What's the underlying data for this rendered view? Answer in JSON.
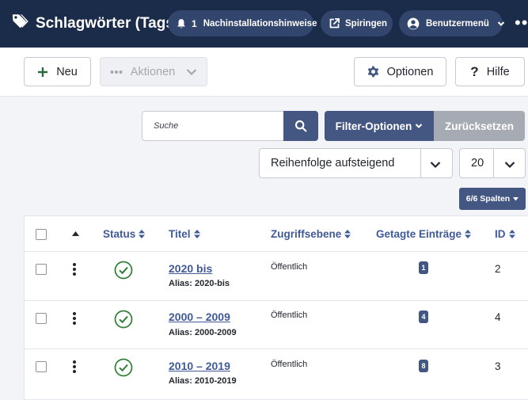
{
  "header": {
    "title": "Schlagwörter (Tags)",
    "notifications_count": "1",
    "notifications_label": "Nachinstallationshinweise",
    "site_label": "Spiringen",
    "user_menu_label": "Benutzermenü",
    "more_label": "••"
  },
  "toolbar": {
    "new_label": "Neu",
    "actions_label": "Aktionen",
    "options_label": "Optionen",
    "help_label": "Hilfe"
  },
  "filters": {
    "search_placeholder": "Suche",
    "filter_options_label": "Filter-Optionen",
    "reset_label": "Zurücksetzen",
    "ordering_value": "Reihenfolge aufsteigend",
    "limit_value": "20",
    "columns_label": "6/6 Spalten"
  },
  "table": {
    "columns": {
      "status": "Status",
      "title": "Titel",
      "access": "Zugriffsebene",
      "tagged": "Getagte Einträge",
      "id": "ID"
    },
    "rows": [
      {
        "title": "2020 bis",
        "alias": "Alias: 2020-bis",
        "access": "Öffentlich",
        "count": "1",
        "id": "2"
      },
      {
        "title": "2000 – 2009",
        "alias": "Alias: 2000-2009",
        "access": "Öffentlich",
        "count": "4",
        "id": "4"
      },
      {
        "title": "2010 – 2019",
        "alias": "Alias: 2010-2019",
        "access": "Öffentlich",
        "count": "8",
        "id": "3"
      }
    ]
  },
  "colors": {
    "header_bg": "#1b2b4a",
    "pill_bg": "#32456c",
    "primary": "#445783",
    "link": "#3f5a96",
    "success": "#2e7d32",
    "disabled": "#a6aab2"
  },
  "icons": {
    "brand": "tags-icon",
    "notifications": "bell-icon",
    "site": "external-link-icon",
    "user": "user-circle-icon",
    "new": "plus-icon",
    "actions": "ellipsis-icon",
    "options": "gear-icon",
    "help": "question-icon",
    "search": "search-icon",
    "status": "check-circle-icon"
  }
}
